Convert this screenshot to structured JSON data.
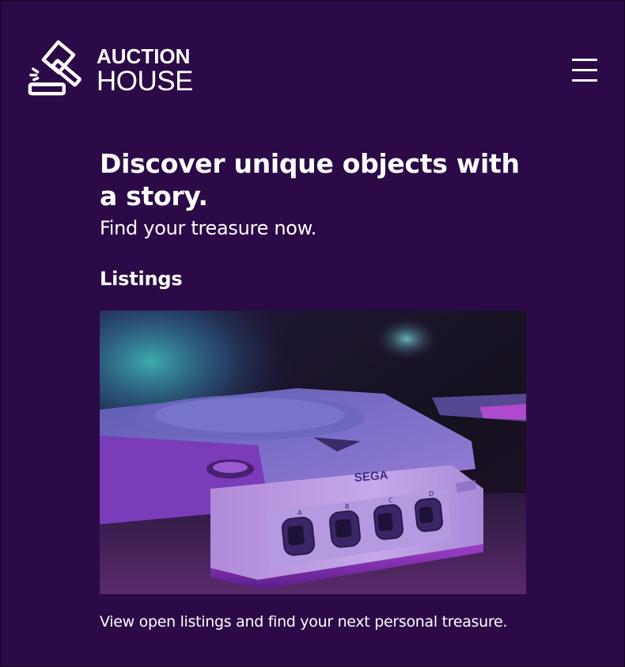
{
  "brand": {
    "line1": "AUCTION",
    "line2": "HOUSE",
    "logo_icon": "gavel-icon"
  },
  "nav": {
    "menu_icon": "hamburger-menu-icon"
  },
  "hero": {
    "title": "Discover unique objects with a story.",
    "subtitle": "Find your treasure now."
  },
  "listings": {
    "heading": "Listings",
    "caption": "View open listings and find your next personal treasure.",
    "image": {
      "subject": "sega-dreamcast-console",
      "brand_text": "SEGA",
      "port_labels": [
        "A",
        "B",
        "C",
        "D"
      ]
    }
  },
  "colors": {
    "background": "#2b0a47",
    "text": "#ffffff"
  }
}
